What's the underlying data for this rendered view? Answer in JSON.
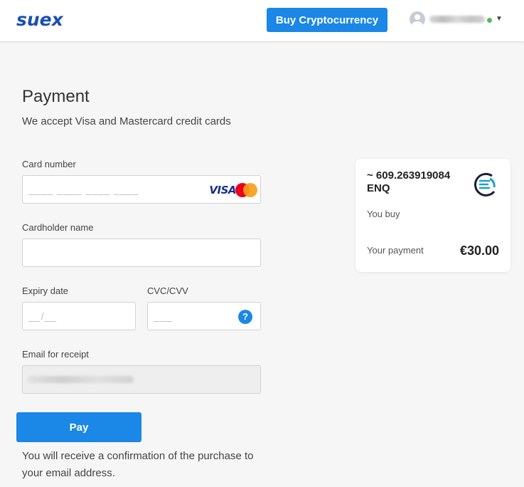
{
  "header": {
    "logo": "suex",
    "buy_button": "Buy Cryptocurrency",
    "user_status_color": "#5cb85c"
  },
  "payment": {
    "title": "Payment",
    "subtitle": "We accept Visa and Mastercard credit cards",
    "card_number": {
      "label": "Card number",
      "placeholder": "____ ____ ____ ____",
      "brand_text": "VISA"
    },
    "cardholder": {
      "label": "Cardholder name",
      "placeholder": ""
    },
    "expiry": {
      "label": "Expiry date",
      "placeholder": "__/__"
    },
    "cvc": {
      "label": "CVC/CVV",
      "placeholder": "___",
      "help": "?"
    },
    "email": {
      "label": "Email for receipt"
    },
    "pay_button": "Pay",
    "confirmation": "You will receive a confirmation of the purchase to your email address."
  },
  "summary": {
    "amount": "~ 609.263919084 ENQ",
    "you_buy": "You buy",
    "your_payment_label": "Your payment",
    "your_payment_value": "€30.00"
  },
  "colors": {
    "accent": "#1b87e6",
    "logo": "#1a4fb4"
  }
}
